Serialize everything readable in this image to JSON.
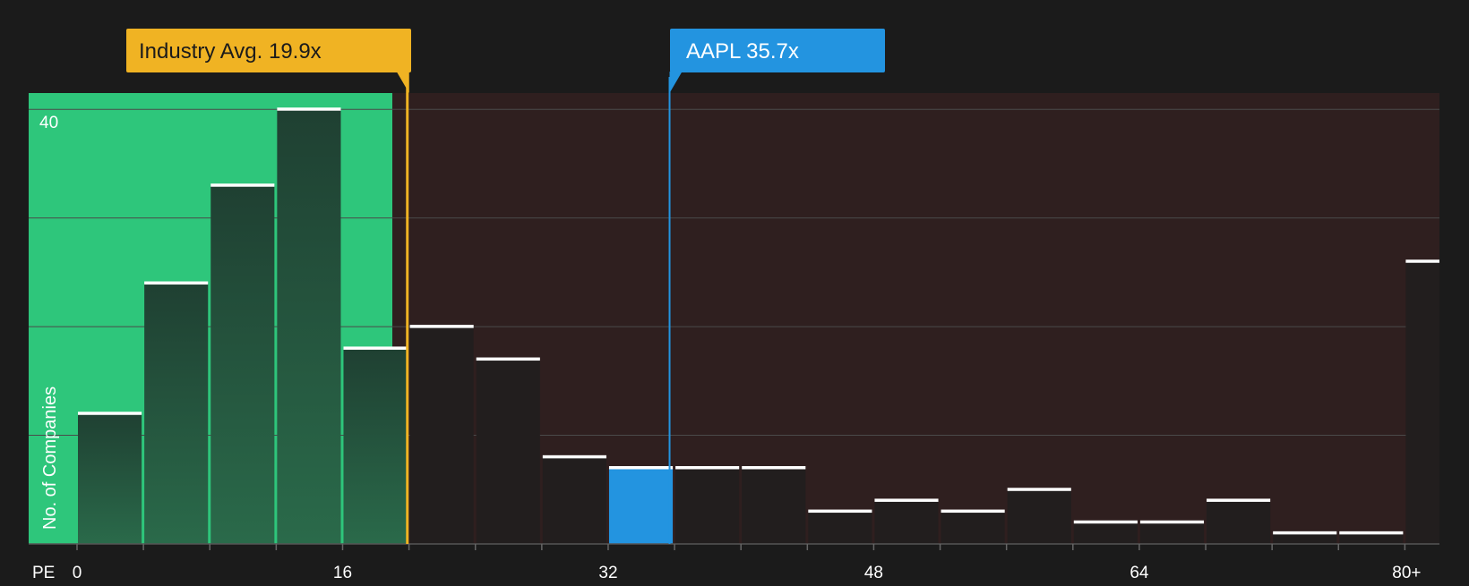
{
  "chart_data": {
    "type": "bar",
    "xlabel": "PE",
    "ylabel": "No. of Companies",
    "x_ticks": [
      "0",
      "16",
      "32",
      "48",
      "64",
      "80+"
    ],
    "y_ticks": [
      "40"
    ],
    "ylim": [
      0,
      41.5
    ],
    "bin_width": 4,
    "bins": [
      {
        "start": 0,
        "value": 12
      },
      {
        "start": 4,
        "value": 24
      },
      {
        "start": 8,
        "value": 33
      },
      {
        "start": 12,
        "value": 40
      },
      {
        "start": 16,
        "value": 18
      },
      {
        "start": 20,
        "value": 20
      },
      {
        "start": 24,
        "value": 17
      },
      {
        "start": 28,
        "value": 8
      },
      {
        "start": 32,
        "value": 7
      },
      {
        "start": 36,
        "value": 7
      },
      {
        "start": 40,
        "value": 7
      },
      {
        "start": 44,
        "value": 3
      },
      {
        "start": 48,
        "value": 4
      },
      {
        "start": 52,
        "value": 3
      },
      {
        "start": 56,
        "value": 5
      },
      {
        "start": 60,
        "value": 2
      },
      {
        "start": 64,
        "value": 2
      },
      {
        "start": 68,
        "value": 4
      },
      {
        "start": 72,
        "value": 1
      },
      {
        "start": 76,
        "value": 1
      },
      {
        "start": 80,
        "value": 26
      }
    ],
    "highlighted_bin_start": 32,
    "industry_avg": {
      "label": "Industry Avg.",
      "value_label": "19.9x",
      "value": 19.9,
      "color": "#f0b323"
    },
    "company": {
      "label": "AAPL",
      "value_label": "35.7x",
      "value": 35.7,
      "color": "#2394e0"
    },
    "colors": {
      "background": "#1b1b1b",
      "below_avg_region": "#2ec67b",
      "above_avg_region": "#2f1f1f",
      "bar_fill": "#224e3a",
      "bar_fill_dark": "#221e1e",
      "bar_cap": "#ffffff",
      "highlight_bar": "#2394e0",
      "gridline": "#4a4a4a",
      "axis_text": "#ffffff"
    }
  }
}
